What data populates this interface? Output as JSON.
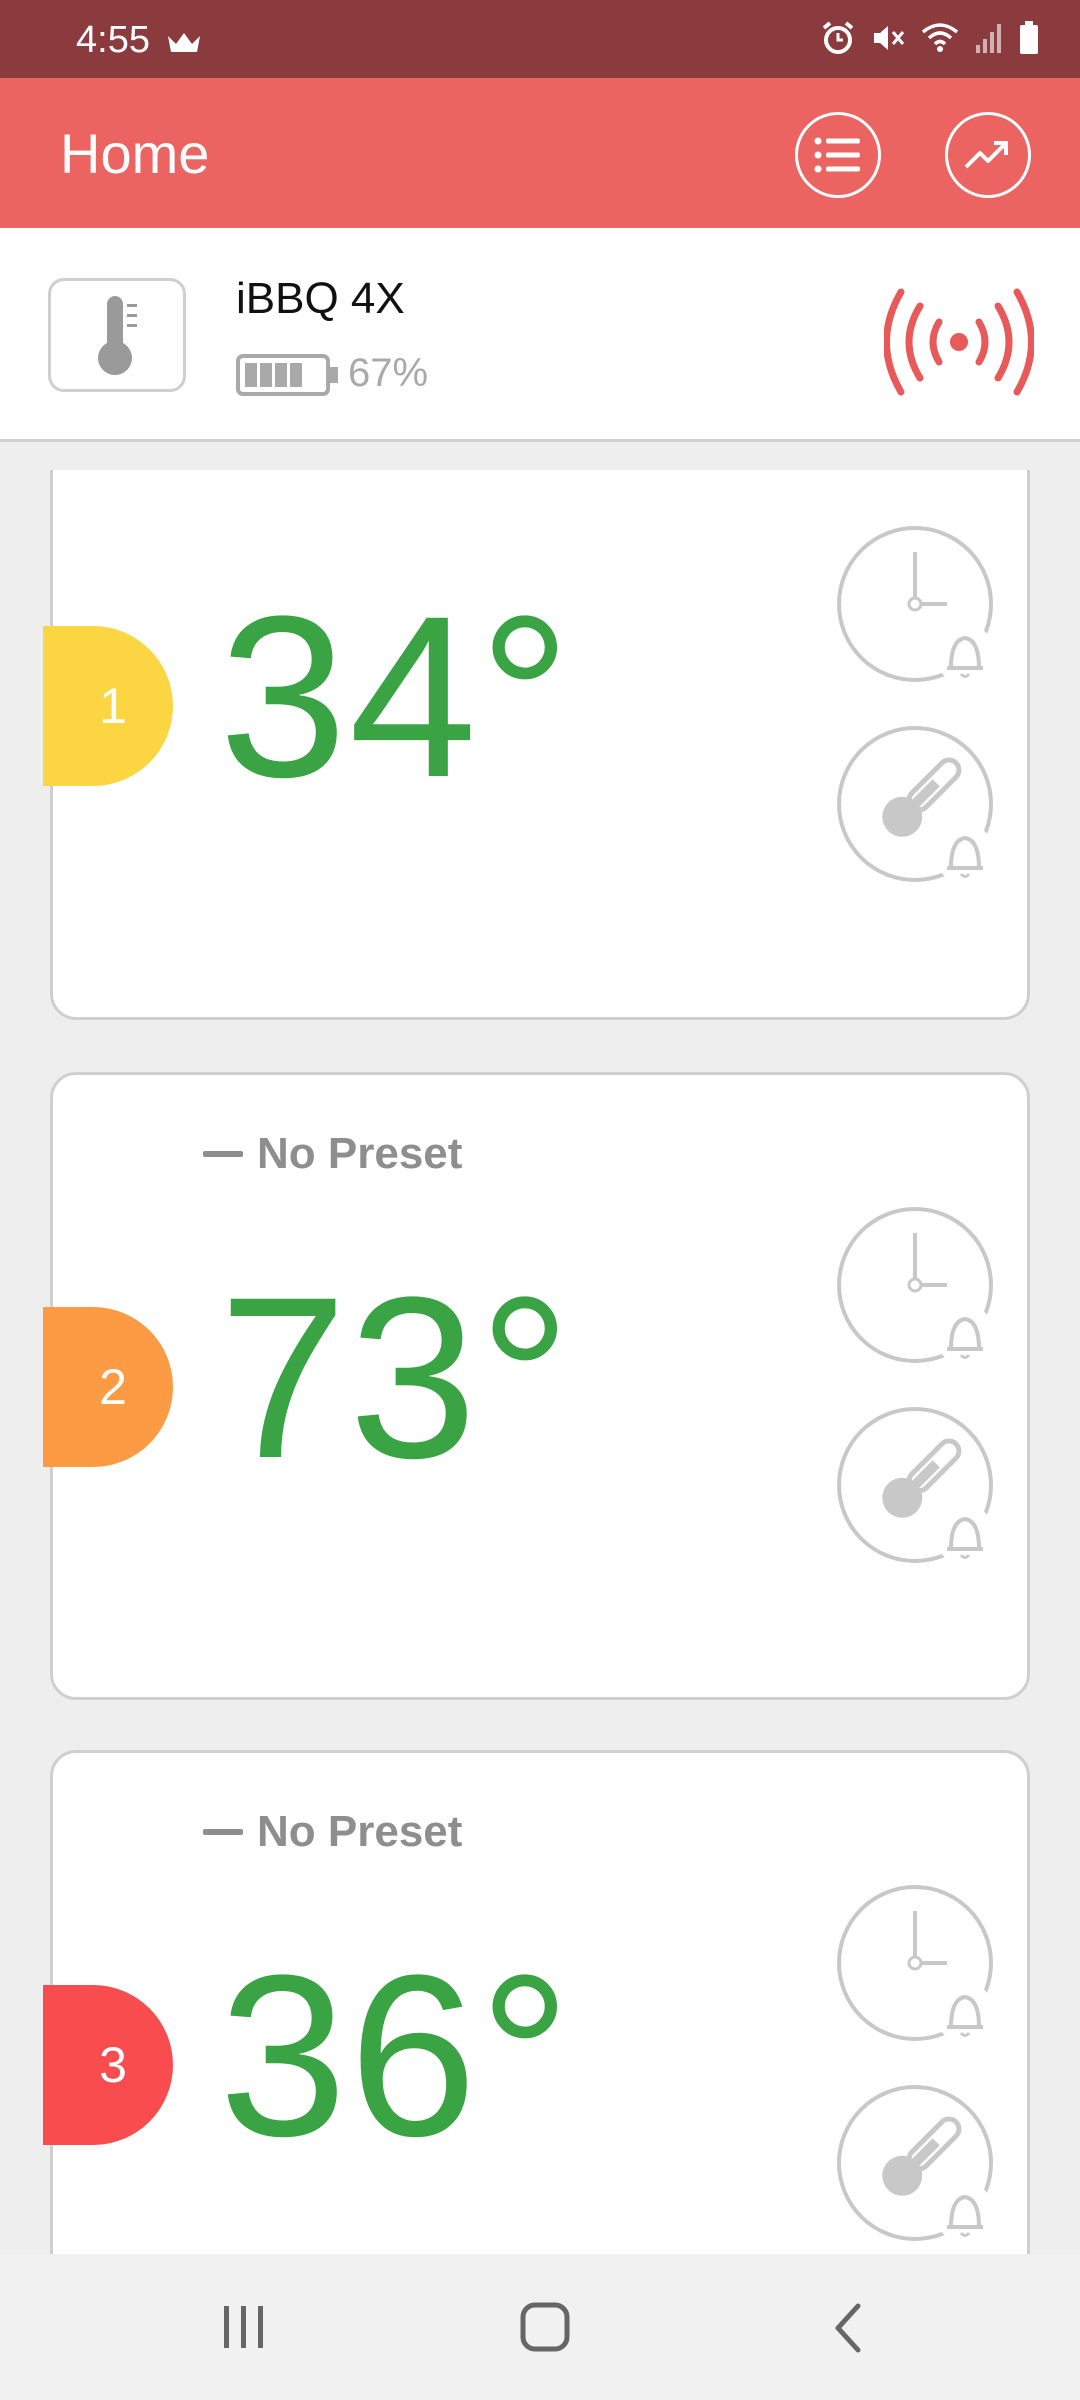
{
  "status_bar": {
    "time": "4:55",
    "icons": [
      "crown-icon",
      "alarm-icon",
      "mute-icon",
      "wifi-icon",
      "signal-icon",
      "battery-icon"
    ]
  },
  "app_bar": {
    "title": "Home",
    "actions": [
      "list-icon",
      "trend-chart-icon"
    ]
  },
  "device": {
    "name": "iBBQ 4X",
    "battery_percent": "67%",
    "battery_level": 0.67,
    "connection_icon": "broadcast-signal-icon"
  },
  "probes": [
    {
      "number": "1",
      "temperature": "34°",
      "preset": "",
      "color": "#fcd642"
    },
    {
      "number": "2",
      "temperature": "73°",
      "preset": "No Preset",
      "color": "#fd9b45"
    },
    {
      "number": "3",
      "temperature": "36°",
      "preset": "No Preset",
      "color": "#f84c4f"
    }
  ],
  "colors": {
    "status_bar": "#8b3a3d",
    "app_bar": "#ec6461",
    "temperature": "#3aa343",
    "connection": "#e85a5a"
  },
  "nav_bar": [
    "recent-apps-icon",
    "home-icon",
    "back-icon"
  ]
}
